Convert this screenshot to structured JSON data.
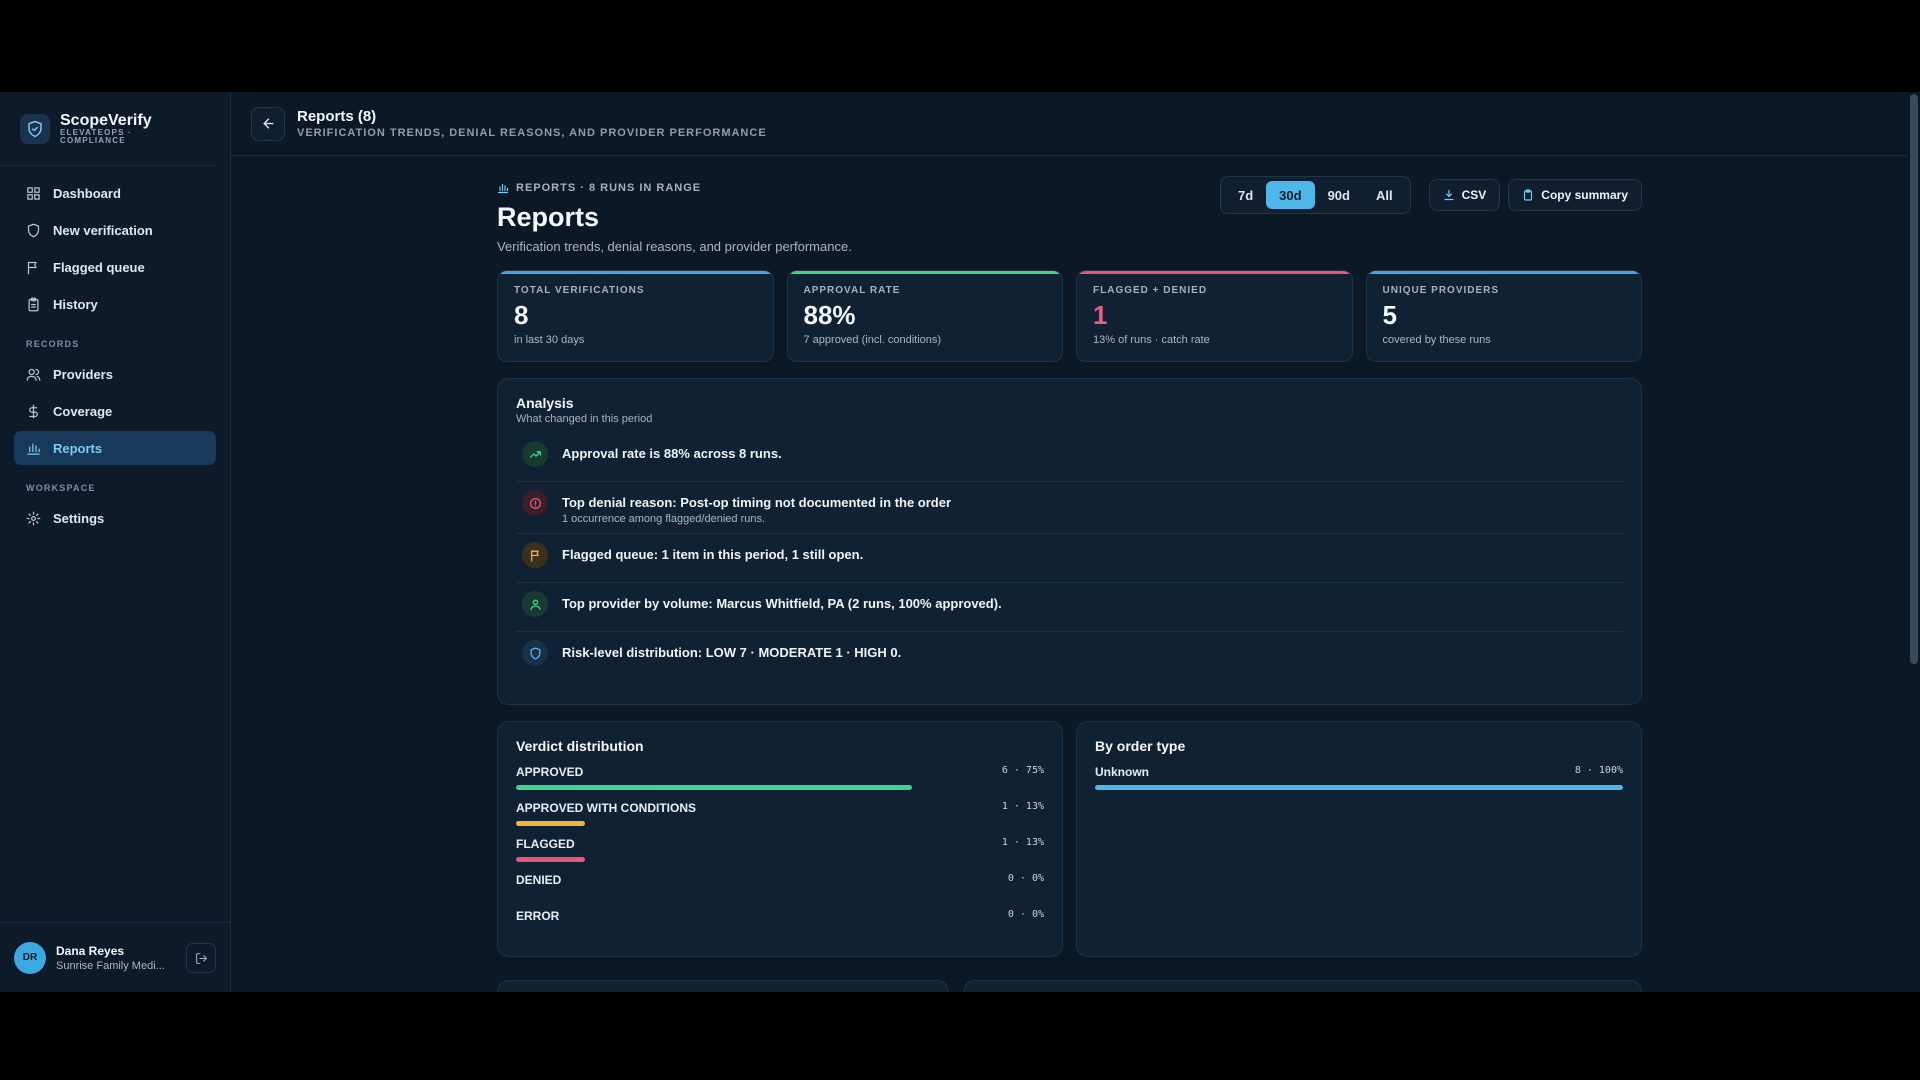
{
  "brand": {
    "name": "ScopeVerify",
    "sub": "ELEVATEOPS · COMPLIANCE"
  },
  "nav": {
    "items": [
      {
        "label": "Dashboard",
        "icon": "grid-icon"
      },
      {
        "label": "New verification",
        "icon": "shield-icon"
      },
      {
        "label": "Flagged queue",
        "icon": "flag-icon"
      },
      {
        "label": "History",
        "icon": "clipboard-icon"
      }
    ],
    "records_label": "RECORDS",
    "records": [
      {
        "label": "Providers",
        "icon": "users-icon"
      },
      {
        "label": "Coverage",
        "icon": "dollar-icon"
      },
      {
        "label": "Reports",
        "icon": "bar-chart-icon",
        "active": true
      }
    ],
    "workspace_label": "WORKSPACE",
    "workspace": [
      {
        "label": "Settings",
        "icon": "gear-icon"
      }
    ]
  },
  "user": {
    "initials": "DR",
    "name": "Dana Reyes",
    "org": "Sunrise Family Medi..."
  },
  "topbar": {
    "title": "Reports (8)",
    "subtitle": "VERIFICATION TRENDS, DENIAL REASONS, AND PROVIDER PERFORMANCE"
  },
  "header": {
    "eyebrow": "REPORTS · 8 RUNS IN RANGE",
    "title": "Reports",
    "description": "Verification trends, denial reasons, and provider performance."
  },
  "ranges": [
    "7d",
    "30d",
    "90d",
    "All"
  ],
  "active_range": "30d",
  "actions": {
    "csv": "CSV",
    "copy": "Copy summary"
  },
  "kpis": [
    {
      "label": "TOTAL VERIFICATIONS",
      "value": "8",
      "note": "in last 30 days",
      "accent": "#3fa9e6",
      "value_color": "#f4f7fb"
    },
    {
      "label": "APPROVAL RATE",
      "value": "88%",
      "note": "7 approved (incl. conditions)",
      "accent": "#3ed28a",
      "value_color": "#f4f7fb"
    },
    {
      "label": "FLAGGED + DENIED",
      "value": "1",
      "note": "13% of runs · catch rate",
      "accent": "#e8557a",
      "value_color": "#ee5a80"
    },
    {
      "label": "UNIQUE PROVIDERS",
      "value": "5",
      "note": "covered by these runs",
      "accent": "#3fa9e6",
      "value_color": "#f4f7fb"
    }
  ],
  "analysis": {
    "title": "Analysis",
    "subtitle": "What changed in this period",
    "items": [
      {
        "text": "Approval rate is 88% across 8 runs.",
        "sub": "",
        "icon": "trending-up-icon",
        "color": "#3ed28a",
        "bg": "#173a33"
      },
      {
        "text": "Top denial reason: Post-op timing not documented in the order",
        "sub": "1 occurrence among flagged/denied runs.",
        "icon": "alert-circle-icon",
        "color": "#e8557a",
        "bg": "#3a1e2c"
      },
      {
        "text": "Flagged queue: 1 item in this period, 1 still open.",
        "sub": "",
        "icon": "flag-icon",
        "color": "#f0b43c",
        "bg": "#3a301c"
      },
      {
        "text": "Top provider by volume: Marcus Whitfield, PA (2 runs, 100% approved).",
        "sub": "",
        "icon": "user-icon",
        "color": "#3ed28a",
        "bg": "#173a33"
      },
      {
        "text": "Risk-level distribution: LOW 7 · MODERATE 1 · HIGH 0.",
        "sub": "",
        "icon": "shield-icon",
        "color": "#4fb6ea",
        "bg": "#17324a"
      }
    ]
  },
  "verdicts": {
    "title": "Verdict distribution",
    "rows": [
      {
        "label": "APPROVED",
        "count": "6 · 75%",
        "pct": 75,
        "color": "#3ed28a"
      },
      {
        "label": "APPROVED WITH CONDITIONS",
        "count": "1 · 13%",
        "pct": 13,
        "color": "#f0b43c"
      },
      {
        "label": "FLAGGED",
        "count": "1 · 13%",
        "pct": 13,
        "color": "#e8557a"
      },
      {
        "label": "DENIED",
        "count": "0 · 0%",
        "pct": 0,
        "color": "#e8557a"
      },
      {
        "label": "ERROR",
        "count": "0 · 0%",
        "pct": 0,
        "color": "#8d9db2"
      }
    ]
  },
  "order_types": {
    "title": "By order type",
    "rows": [
      {
        "label": "Unknown",
        "count": "8 · 100%",
        "pct": 100,
        "color": "#4fb6ea"
      }
    ]
  }
}
